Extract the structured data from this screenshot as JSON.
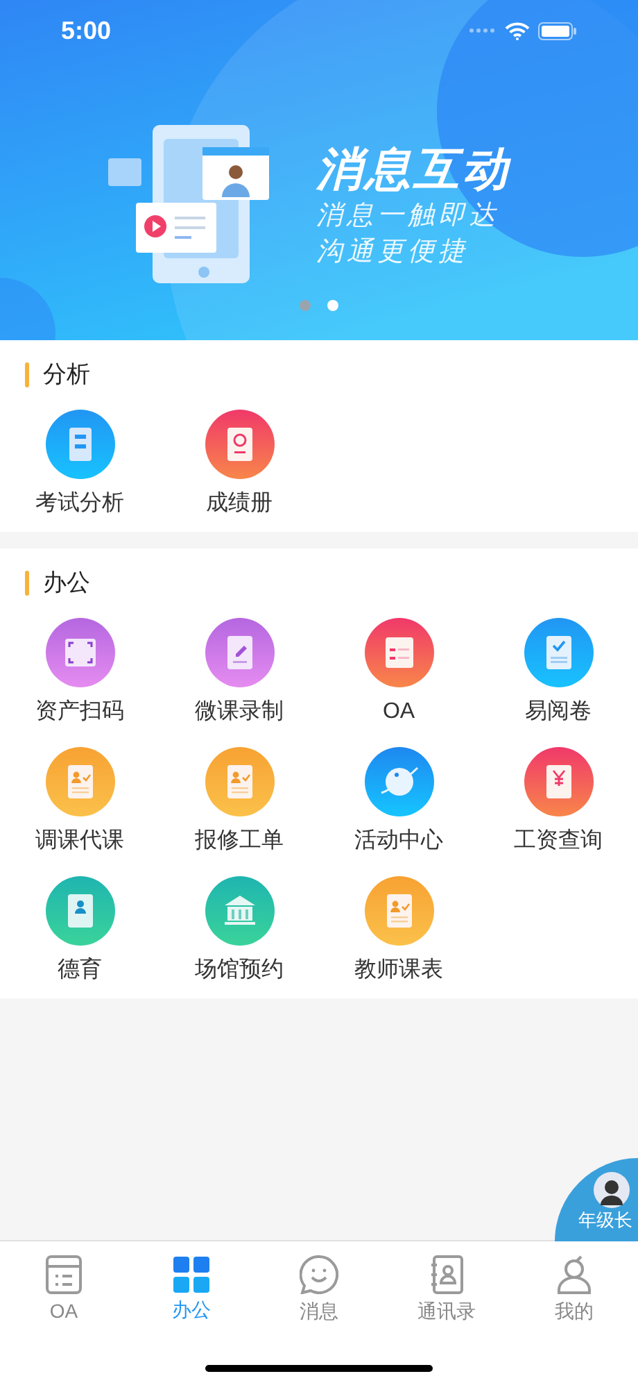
{
  "status_bar": {
    "time": "5:00"
  },
  "banner": {
    "title": "消息互动",
    "lines": [
      "消息一触即达",
      "沟通更便捷"
    ],
    "dots": [
      {
        "selected": false
      },
      {
        "selected": true
      }
    ]
  },
  "sections": [
    {
      "title": "分析",
      "items": [
        {
          "label": "考试分析",
          "kind": "doc"
        },
        {
          "label": "成绩册",
          "kind": "notebook"
        }
      ]
    },
    {
      "title": "办公",
      "items": [
        {
          "label": "资产扫码",
          "kind": "scan"
        },
        {
          "label": "微课录制",
          "kind": "clipboard"
        },
        {
          "label": "OA",
          "kind": "form"
        },
        {
          "label": "易阅卷",
          "kind": "check"
        },
        {
          "label": "调课代课",
          "kind": "persondoc"
        },
        {
          "label": "报修工单",
          "kind": "persondoc"
        },
        {
          "label": "活动中心",
          "kind": "planet"
        },
        {
          "label": "工资查询",
          "kind": "yen"
        },
        {
          "label": "德育",
          "kind": "contact"
        },
        {
          "label": "场馆预约",
          "kind": "bank"
        },
        {
          "label": "教师课表",
          "kind": "persondoc"
        }
      ]
    }
  ],
  "floating_badge": {
    "label": "年级长"
  },
  "tab_bar": [
    {
      "label": "OA",
      "kind": "calendar",
      "selected": false
    },
    {
      "label": "办公",
      "kind": "grid",
      "selected": true
    },
    {
      "label": "消息",
      "kind": "chat",
      "selected": false
    },
    {
      "label": "通讯录",
      "kind": "contacts",
      "selected": false
    },
    {
      "label": "我的",
      "kind": "person",
      "selected": false
    }
  ]
}
